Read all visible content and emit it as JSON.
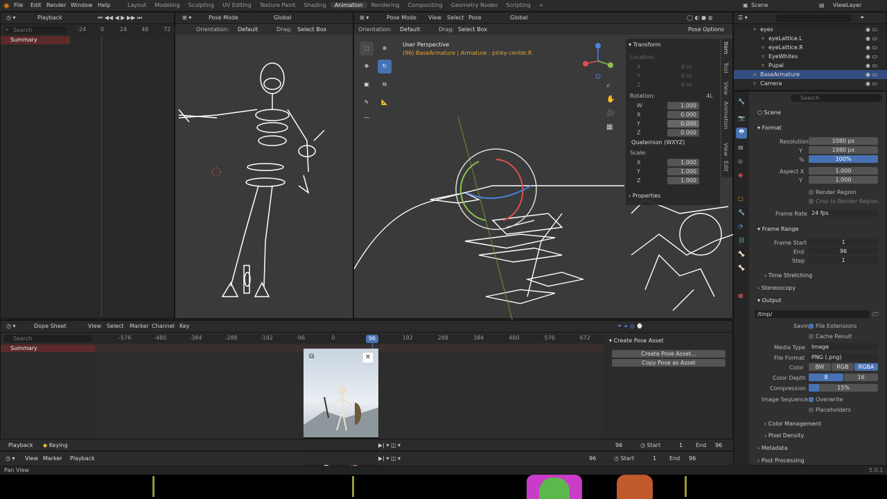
{
  "menubar": {
    "items": [
      "File",
      "Edit",
      "Render",
      "Window",
      "Help"
    ],
    "playback": "Playback"
  },
  "workspaces": [
    "Layout",
    "Modeling",
    "Sculpting",
    "UV Editing",
    "Texture Paint",
    "Shading",
    "Animation",
    "Rendering",
    "Compositing",
    "Geometry Nodes",
    "Scripting"
  ],
  "workspace_add": "+",
  "topright": {
    "scene": "Scene",
    "view_layer": "ViewLayer"
  },
  "timeline_top": {
    "search_placeholder": "Search",
    "summary": "Summary",
    "ticks": [
      "-24",
      "0",
      "24",
      "48",
      "72"
    ]
  },
  "left_view": {
    "orientation": "Orientation:",
    "orientation_val": "Default",
    "drag": "Drag:",
    "drag_val": "Select Box"
  },
  "main_view": {
    "mode": "Pose Mode",
    "view": "View",
    "select": "Select",
    "pose": "Pose",
    "transform": "Global",
    "orientation": "Orientation:",
    "orientation_val": "Default",
    "drag": "Drag:",
    "drag_val": "Select Box",
    "pose_options": "Pose Options",
    "title": "User Perspective",
    "subtitle": "(96) BaseArmature | Armature : pinky-center.R"
  },
  "left_mode": {
    "mode": "Pose Mode",
    "global": "Global"
  },
  "npanel": {
    "transform": "Transform",
    "location": "Location:",
    "loc": [
      {
        "axis": "X",
        "val": "0 m"
      },
      {
        "axis": "Y",
        "val": "0 m"
      },
      {
        "axis": "Z",
        "val": "0 m"
      }
    ],
    "rotation": "Rotation:",
    "rot_mode_short": "4L",
    "rot": [
      {
        "axis": "W",
        "val": "1.000"
      },
      {
        "axis": "X",
        "val": "0.000"
      },
      {
        "axis": "Y",
        "val": "0.000"
      },
      {
        "axis": "Z",
        "val": "0.000"
      }
    ],
    "rot_mode": "Quaternion (WXYZ)",
    "scale": "Scale:",
    "scl": [
      {
        "axis": "X",
        "val": "1.000"
      },
      {
        "axis": "Y",
        "val": "1.000"
      },
      {
        "axis": "Z",
        "val": "1.000"
      }
    ],
    "properties": "Properties",
    "tabs": [
      "Item",
      "Tool",
      "View",
      "Animation",
      "View",
      "Edit"
    ]
  },
  "outliner": {
    "items": [
      {
        "name": "eyes",
        "indent": 2
      },
      {
        "name": "eyeLattice.L",
        "indent": 3
      },
      {
        "name": "eyeLattice.R",
        "indent": 3
      },
      {
        "name": "EyeWhites",
        "indent": 3
      },
      {
        "name": "Pupal",
        "indent": 3
      },
      {
        "name": "BaseArmature",
        "indent": 2,
        "selected": true
      },
      {
        "name": "Camera",
        "indent": 2
      }
    ]
  },
  "props": {
    "search_placeholder": "Search",
    "scene": "Scene",
    "format": "Format",
    "resolution_x_label": "Resolution X",
    "resolution_x": "1080 px",
    "y_label": "Y",
    "resolution_y": "1980 px",
    "pct_label": "%",
    "pct": "100%",
    "aspect_x_label": "Aspect X",
    "aspect_x": "1.000",
    "aspect_y": "1.000",
    "render_region": "Render Region",
    "crop": "Crop to Render Region",
    "frame_rate_label": "Frame Rate",
    "frame_rate": "24 fps",
    "frame_range": "Frame Range",
    "frame_start_label": "Frame Start",
    "frame_start": "1",
    "end_label": "End",
    "end": "96",
    "step_label": "Step",
    "step": "1",
    "time_stretching": "Time Stretching",
    "stereoscopy": "Stereoscopy",
    "output": "Output",
    "path": "/tmp/",
    "saving": "Saving",
    "file_ext": "File Extensions",
    "cache_result": "Cache Result",
    "media_type_label": "Media Type",
    "media_type": "Image",
    "file_format_label": "File Format",
    "file_format": "PNG (.png)",
    "color_label": "Color",
    "color_bw": "BW",
    "color_rgb": "RGB",
    "color_rgba": "RGBA",
    "depth_label": "Color Depth",
    "depth_8": "8",
    "depth_16": "16",
    "compression_label": "Compression",
    "compression": "15%",
    "img_seq_label": "Image Sequence",
    "overwrite": "Overwrite",
    "placeholders": "Placeholders",
    "color_mgmt": "Color Management",
    "pixel_density": "Pixel Density",
    "metadata": "Metadata",
    "post_processing": "Post Processing"
  },
  "dopesheet": {
    "editor": "Dope Sheet",
    "view": "View",
    "select": "Select",
    "marker": "Marker",
    "channel": "Channel",
    "key": "Key",
    "search_placeholder": "Search",
    "summary": "Summary",
    "ticks": [
      "-576",
      "-480",
      "-384",
      "-288",
      "-192",
      "-96",
      "0",
      "96",
      "192",
      "288",
      "384",
      "480",
      "576",
      "672"
    ],
    "current_frame": "96",
    "create_pose_asset_panel": "Create Pose Asset",
    "create_btn": "Create Pose Asset...",
    "copy_btn": "Copy Pose as Asset"
  },
  "bottom_bar": {
    "playback": "Playback",
    "keying": "Keying",
    "view": "View",
    "marker": "Marker",
    "frame1": "96",
    "start1": "Start",
    "start1_val": "1",
    "end1": "End",
    "end1_val": "96",
    "frame2": "96",
    "start2": "Start",
    "start2_val": "1",
    "end2": "End",
    "end2_val": "96"
  },
  "status": {
    "left": "Pan View",
    "version": "5.0.1"
  },
  "colors": {
    "accent": "#4772b3",
    "selected_row": "#334d80",
    "summary_red": "#5c2a2a",
    "header": "#2a2a2a",
    "viewport": "#3a3a3a"
  }
}
